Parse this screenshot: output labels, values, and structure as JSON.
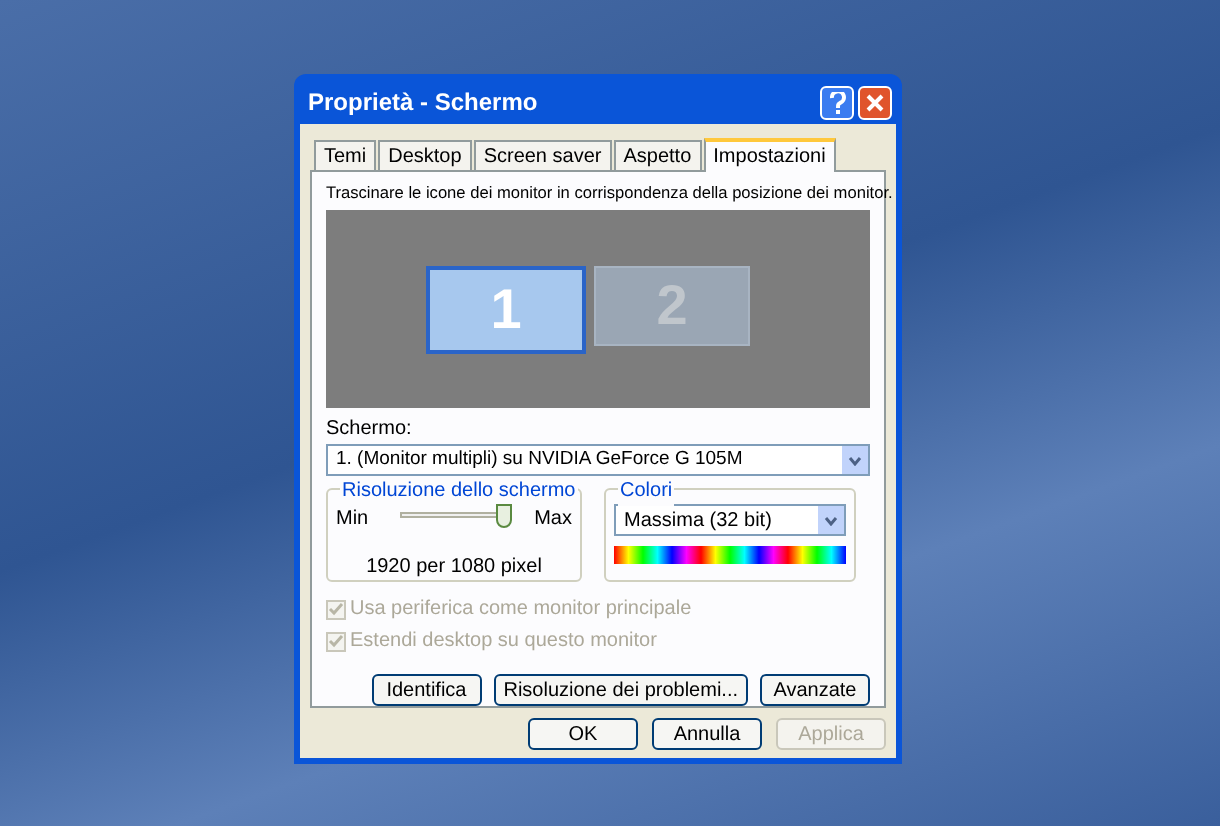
{
  "window": {
    "title": "Proprietà - Schermo"
  },
  "tabs": [
    {
      "label": "Temi",
      "selected": false
    },
    {
      "label": "Desktop",
      "selected": false
    },
    {
      "label": "Screen saver",
      "selected": false
    },
    {
      "label": "Aspetto",
      "selected": false
    },
    {
      "label": "Impostazioni",
      "selected": true
    }
  ],
  "instruction": "Trascinare le icone dei monitor in corrispondenza della posizione dei monitor.",
  "monitors": [
    {
      "label": "1",
      "selected": true
    },
    {
      "label": "2",
      "selected": false
    }
  ],
  "display": {
    "label": "Schermo:",
    "value": "1. (Monitor multipli) su NVIDIA GeForce G 105M"
  },
  "resolution": {
    "title": "Risoluzione dello schermo",
    "min_label": "Min",
    "max_label": "Max",
    "level": 1,
    "reading": "1920 per 1080 pixel"
  },
  "colors": {
    "title": "Colori",
    "value": "Massima (32 bit)"
  },
  "checkboxes": [
    {
      "label": "Usa periferica come monitor principale",
      "checked": true,
      "disabled": true
    },
    {
      "label": "Estendi desktop su questo monitor",
      "checked": true,
      "disabled": true
    }
  ],
  "panel_buttons": [
    "Identifica",
    "Risoluzione dei problemi...",
    "Avanzate"
  ],
  "dialog_buttons": [
    {
      "label": "OK",
      "disabled": false
    },
    {
      "label": "Annulla",
      "disabled": false
    },
    {
      "label": "Applica",
      "disabled": true
    }
  ]
}
